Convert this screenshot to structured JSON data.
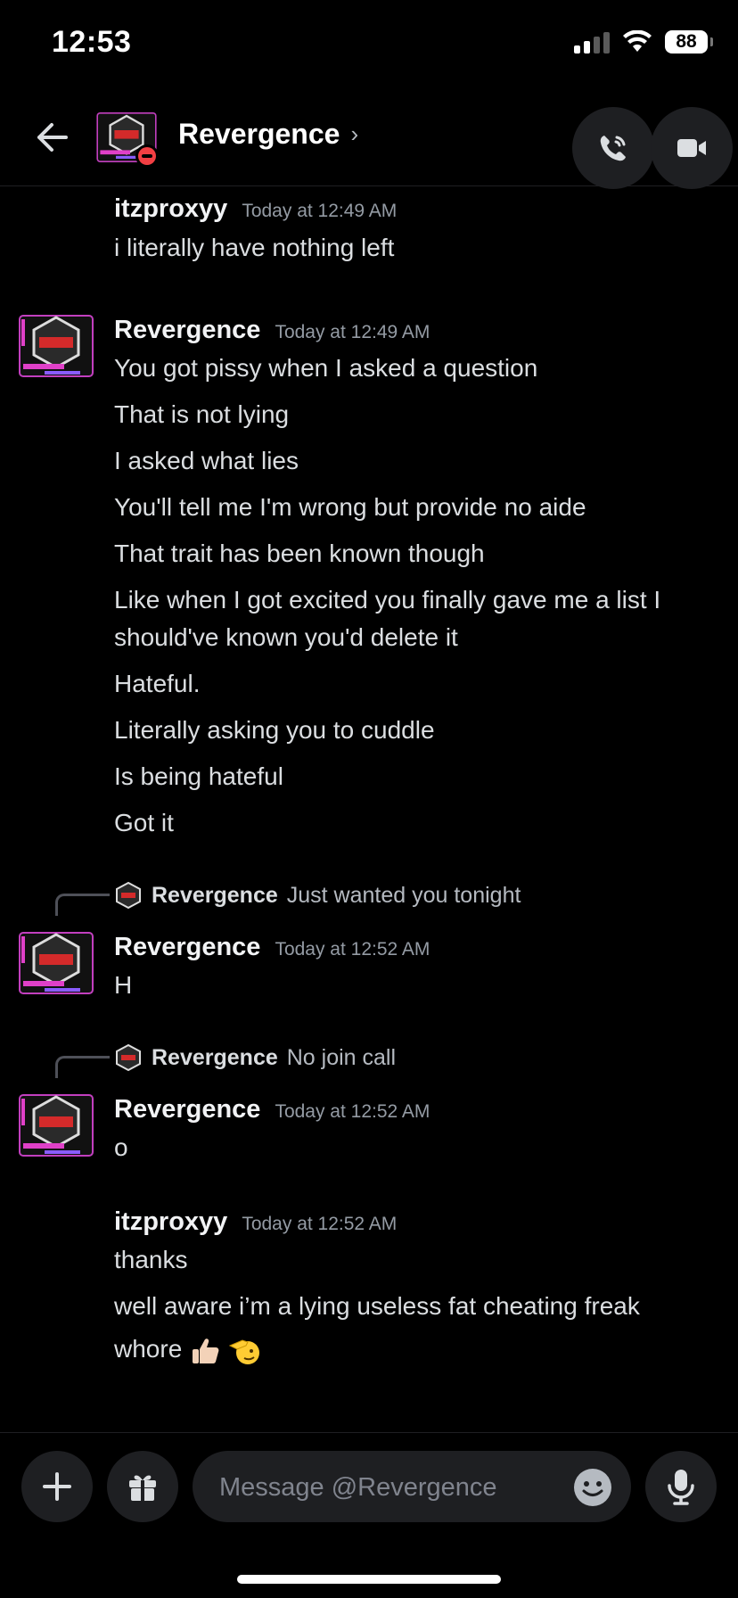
{
  "status_bar": {
    "time": "12:53",
    "battery": "88"
  },
  "header": {
    "title": "Revergence",
    "chevron": "›"
  },
  "messages": [
    {
      "author": "itzproxyy",
      "timestamp": "Today at 12:49 AM",
      "lines": [
        "i literally have nothing left"
      ]
    },
    {
      "author": "Revergence",
      "timestamp": "Today at 12:49 AM",
      "lines": [
        "You got pissy when I asked a question",
        "That is not lying",
        "I asked what lies",
        "You'll tell me I'm wrong but provide no aide",
        "That trait has been known though",
        "Like when I got excited you finally  gave me a list I",
        "should've known you'd delete it",
        "Hateful.",
        "Literally asking you to cuddle",
        "Is being hateful",
        "Got it"
      ]
    },
    {
      "reply": {
        "author": "Revergence",
        "text": "Just wanted you tonight"
      },
      "author": "Revergence",
      "timestamp": "Today at 12:52 AM",
      "lines": [
        "H"
      ]
    },
    {
      "reply": {
        "author": "Revergence",
        "text": "No join call"
      },
      "author": "Revergence",
      "timestamp": "Today at 12:52 AM",
      "lines": [
        "o"
      ]
    },
    {
      "author": "itzproxyy",
      "timestamp": "Today at 12:52 AM",
      "lines": [
        "thanks",
        "well aware i’m a lying useless fat cheating freak",
        "whore"
      ]
    }
  ],
  "composer": {
    "placeholder": "Message @Revergence"
  },
  "icons": {
    "back": "arrow-left-icon",
    "call": "phone-icon",
    "video": "video-camera-icon",
    "plus": "plus-icon",
    "gift": "gift-icon",
    "emoji": "smiley-icon",
    "mic": "microphone-icon",
    "dnd": "do-not-disturb-icon"
  },
  "colors": {
    "background": "#000000",
    "dnd": "#f23f43",
    "avatar_accent": "#e040c8"
  }
}
